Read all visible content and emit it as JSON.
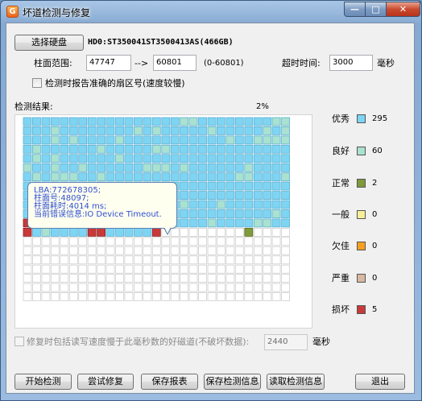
{
  "window": {
    "title": "坏道检测与修复",
    "app_icon_glyph": "G",
    "minimize_glyph": "—",
    "maximize_glyph": "□",
    "close_glyph": "✕"
  },
  "disk": {
    "select_button": "选择硬盘",
    "disk_name": "HD0:ST350041ST3500413AS(466GB)"
  },
  "range": {
    "label": "柱面范围:",
    "start": "47747",
    "arrow": "-->",
    "end": "60801",
    "hint": "(0-60801)"
  },
  "timeout": {
    "label": "超时时间:",
    "value": "3000",
    "unit": "毫秒"
  },
  "report_sector": {
    "label": "检测时报告准确的扇区号(速度较慢)",
    "checked": false
  },
  "results": {
    "label": "检测结果:",
    "progress_text": "2%"
  },
  "blocks": {
    "cols": 29,
    "rows": 20,
    "counts": {
      "excellent": 295,
      "good": 60,
      "normal": 2,
      "damaged": 5
    },
    "colors": {
      "untested_fill": "#ffffff",
      "untested_border": "#cfcfcf",
      "excellent": "#7ed4f3",
      "good": "#a9e2d0",
      "normal": "#7f9a3a",
      "fair": "#f7ee9a",
      "poor": "#f5a020",
      "severe": "#d8b8a0",
      "damaged": "#c83a3a"
    }
  },
  "tooltip": {
    "lba": "LBA:772678305;",
    "cylinder": "柱面号:48097;",
    "time": "柱面耗时:4014 ms;",
    "error": "当前错误信息:IO Device Timeout."
  },
  "legend": [
    {
      "key": "excellent",
      "label": "优秀",
      "count": "295",
      "color": "#7ed4f3"
    },
    {
      "key": "good",
      "label": "良好",
      "count": "60",
      "color": "#a9e2d0"
    },
    {
      "key": "normal",
      "label": "正常",
      "count": "2",
      "color": "#7f9a3a"
    },
    {
      "key": "fair",
      "label": "一般",
      "count": "0",
      "color": "#f7ee9a"
    },
    {
      "key": "poor",
      "label": "欠佳",
      "count": "0",
      "color": "#f5a020"
    },
    {
      "key": "severe",
      "label": "严重",
      "count": "0",
      "color": "#d8b8a0"
    },
    {
      "key": "damaged",
      "label": "损坏",
      "count": "5",
      "color": "#c83a3a"
    }
  ],
  "repair_option": {
    "label": "修复时包括读写速度慢于此毫秒数的好磁道(不破坏数据):",
    "value": "2440",
    "unit": "毫秒",
    "checked": false,
    "enabled": false
  },
  "buttons": {
    "start": "开始检测",
    "repair": "尝试修复",
    "save_report": "保存报表",
    "save_info": "保存检测信息",
    "load_info": "读取检测信息",
    "exit": "退出"
  }
}
